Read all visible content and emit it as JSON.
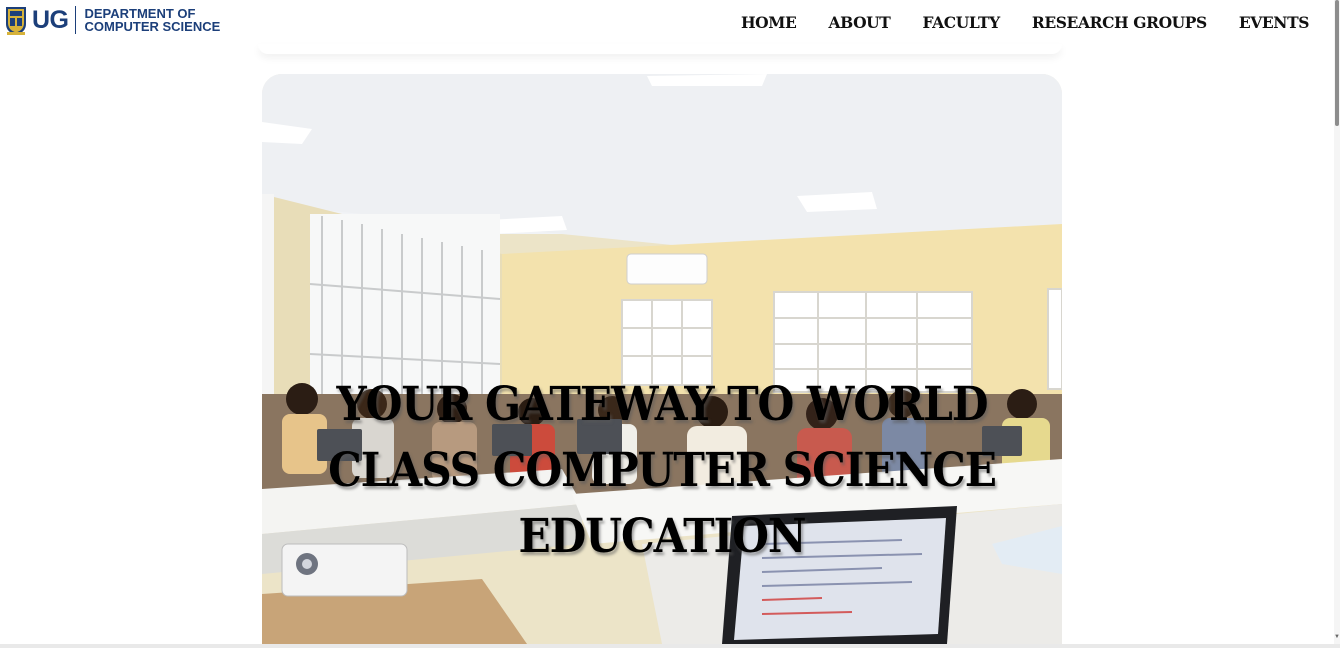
{
  "brand": {
    "short": "UG",
    "dept_line1": "DEPARTMENT OF",
    "dept_line2": "COMPUTER SCIENCE",
    "crest_icon": "university-crest-icon",
    "color": "#1c3f7a"
  },
  "nav": {
    "items": [
      "HOME",
      "ABOUT",
      "FACULTY",
      "RESEARCH GROUPS",
      "EVENTS"
    ]
  },
  "hero": {
    "title_line1": "YOUR GATEWAY TO WORLD",
    "title_line2": "CLASS COMPUTER SCIENCE",
    "title_line3": "EDUCATION"
  }
}
